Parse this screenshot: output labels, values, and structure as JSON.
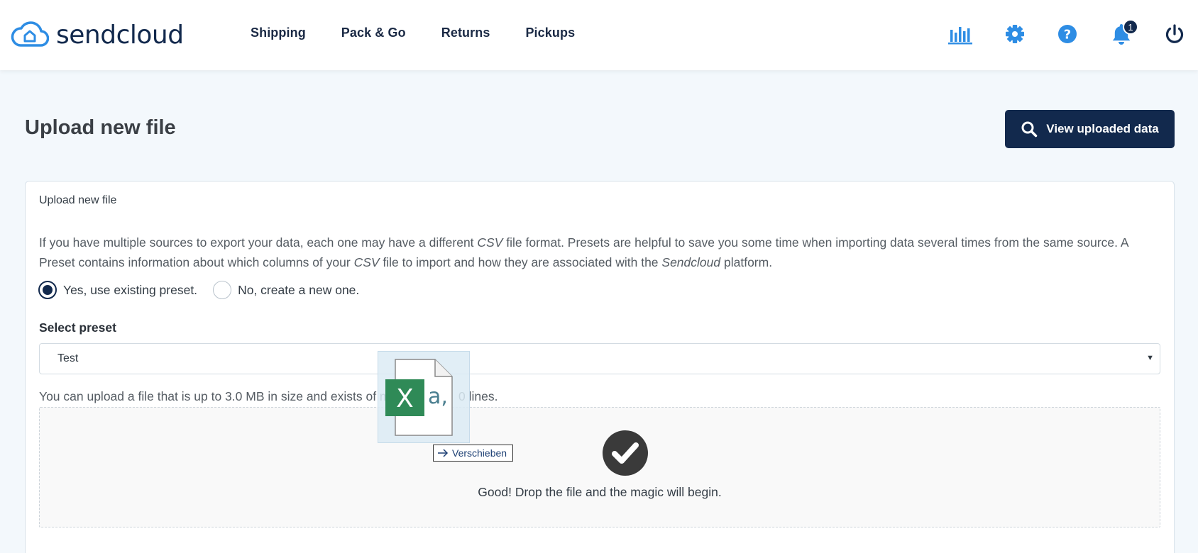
{
  "brand": {
    "name": "sendcloud",
    "color": "#12294d",
    "accent": "#2e8de4"
  },
  "nav": [
    {
      "label": "Shipping"
    },
    {
      "label": "Pack & Go"
    },
    {
      "label": "Returns"
    },
    {
      "label": "Pickups"
    }
  ],
  "top_icons": [
    "analytics-icon",
    "gear-icon",
    "help-icon",
    "bell-icon",
    "power-icon"
  ],
  "notifications": {
    "count": "1"
  },
  "page": {
    "title": "Upload new file",
    "view_button_label": "View uploaded data"
  },
  "card": {
    "header": "Upload new file",
    "description_parts": {
      "p1": "If you have multiple sources to export your data, each one may have a different ",
      "csv1": "CSV",
      "p2": " file format. Presets are helpful to save you some time when importing data several times from the same source. A Preset contains information about which columns of your ",
      "csv2": "CSV",
      "p3": " file to import and how they are associated with the ",
      "brand": "Sendcloud",
      "p4": " platform."
    },
    "radio_options": [
      {
        "label": "Yes, use existing preset.",
        "checked": true
      },
      {
        "label": "No, create a new one.",
        "checked": false
      }
    ],
    "select_label": "Select preset",
    "select_value": "Test",
    "upload_note": "You can upload a file that is up to 3.0 MB in size and exists of max",
    "upload_note_tail": "0 lines.",
    "drop_text": "Good! Drop the file and the magic will begin."
  },
  "drag": {
    "file_icon_letter": "X",
    "file_icon_text": "a,",
    "tooltip_label": "Verschieben"
  }
}
